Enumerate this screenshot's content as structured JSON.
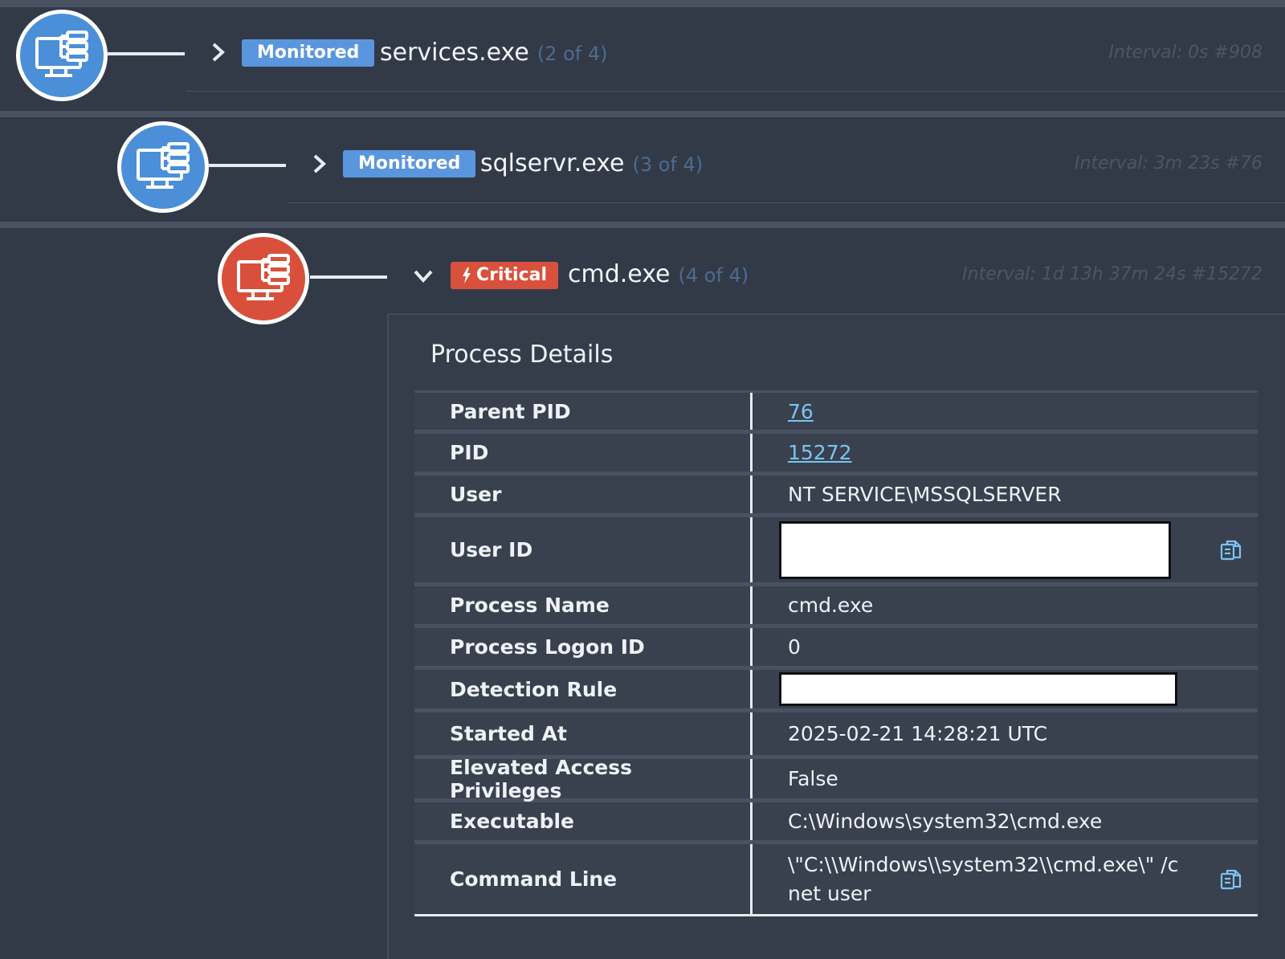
{
  "tree": [
    {
      "badge": "Monitored",
      "name": "services.exe",
      "count": "(2 of 4)",
      "interval": "Interval: 0s #908",
      "expanded": false,
      "status_color": "#4a8fd8"
    },
    {
      "badge": "Monitored",
      "name": "sqlservr.exe",
      "count": "(3 of 4)",
      "interval": "Interval: 3m 23s #76",
      "expanded": false,
      "status_color": "#4a8fd8"
    },
    {
      "badge": "Critical",
      "name": "cmd.exe",
      "count": "(4 of 4)",
      "interval": "Interval: 1d 13h 37m 24s #15272",
      "expanded": true,
      "status_color": "#d8503c"
    }
  ],
  "details": {
    "title": "Process Details",
    "rows": [
      {
        "label": "Parent PID",
        "value": "76"
      },
      {
        "label": "PID",
        "value": "15272"
      },
      {
        "label": "User",
        "value": "NT SERVICE\\MSSQLSERVER"
      },
      {
        "label": "User ID",
        "value": ""
      },
      {
        "label": "Process Name",
        "value": "cmd.exe"
      },
      {
        "label": "Process Logon ID",
        "value": "0"
      },
      {
        "label": "Detection Rule",
        "value": ""
      },
      {
        "label": "Started At",
        "value": "2025-02-21 14:28:21 UTC"
      },
      {
        "label": "Elevated Access Privileges",
        "value": "False"
      },
      {
        "label": "Executable",
        "value": "C:\\Windows\\system32\\cmd.exe"
      },
      {
        "label": "Command Line",
        "value": "\\\"C:\\\\Windows\\\\system32\\\\cmd.exe\\\" /c net user"
      }
    ]
  },
  "icons": {
    "node": "computer-process-icon",
    "expand": "chevron-right-icon",
    "collapse": "chevron-down-icon",
    "critical": "lightning-bolt-icon",
    "copy": "copy-icon"
  },
  "colors": {
    "background": "#323a48",
    "monitored": "#5a96de",
    "critical": "#d9503c",
    "link": "#7cc4f0"
  }
}
